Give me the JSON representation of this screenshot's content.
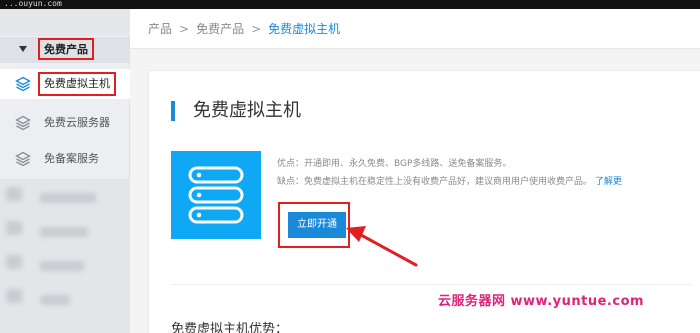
{
  "topbar": {
    "url_fragment": "...ouyun.com"
  },
  "sidebar": {
    "group_label": "免费产品",
    "items": [
      {
        "label": "免费虚拟主机",
        "icon": "layers-icon",
        "active": true
      },
      {
        "label": "免费云服务器",
        "icon": "layers-icon",
        "active": false
      },
      {
        "label": "免备案服务",
        "icon": "layers-icon",
        "active": false
      }
    ]
  },
  "breadcrumb": {
    "items": [
      "产品",
      "免费产品",
      "免费虚拟主机"
    ],
    "separator": ">"
  },
  "card": {
    "title": "免费虚拟主机",
    "advantages": "优点：开通即用、永久免费、BGP多线路、送免备案服务。",
    "disadvantages": "缺点：免费虚拟主机在稳定性上没有收费产品好，建议商用用户使用收费产品。",
    "learn_more": "了解更",
    "open_button": "立即开通",
    "section_title": "免费虚拟主机优势："
  },
  "watermark": "云服务器网 www.yuntue.com",
  "colors": {
    "accent": "#1a8ad8",
    "product_icon_bg": "#0fa8f5",
    "annotation_red": "#e02020",
    "watermark": "#e0237a"
  }
}
